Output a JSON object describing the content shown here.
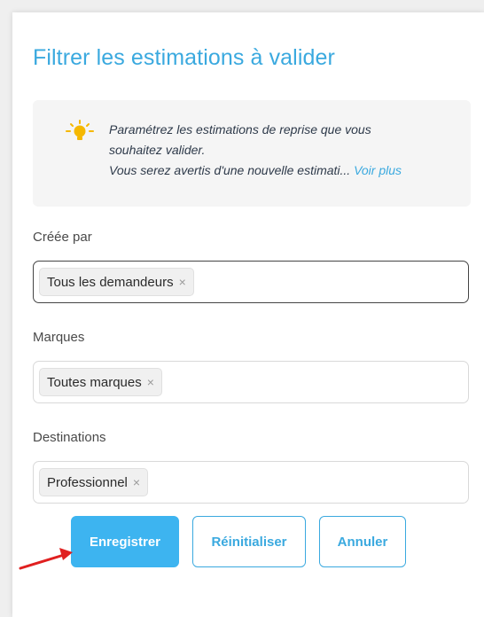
{
  "form": {
    "title": "Filtrer les estimations à valider",
    "info": {
      "icon": "lightbulb-icon",
      "icon_color": "#f5b800",
      "line1": "Paramétrez les estimations de reprise que vous",
      "line2": "souhaitez valider.",
      "line3": "Vous serez avertis d'une nouvelle estimati...",
      "voir_plus": "Voir plus"
    },
    "fields": {
      "created_by": {
        "label": "Créée par",
        "chip": "Tous les demandeurs"
      },
      "brands": {
        "label": "Marques",
        "chip": "Toutes marques"
      },
      "destinations": {
        "label": "Destinations",
        "chip": "Professionnel"
      }
    },
    "chip_remove_glyph": "×",
    "buttons": {
      "save": "Enregistrer",
      "reset": "Réinitialiser",
      "cancel": "Annuler"
    }
  },
  "colors": {
    "accent": "#3aa9df",
    "primary_button": "#3db4f0",
    "annotation_arrow": "#e02020"
  }
}
